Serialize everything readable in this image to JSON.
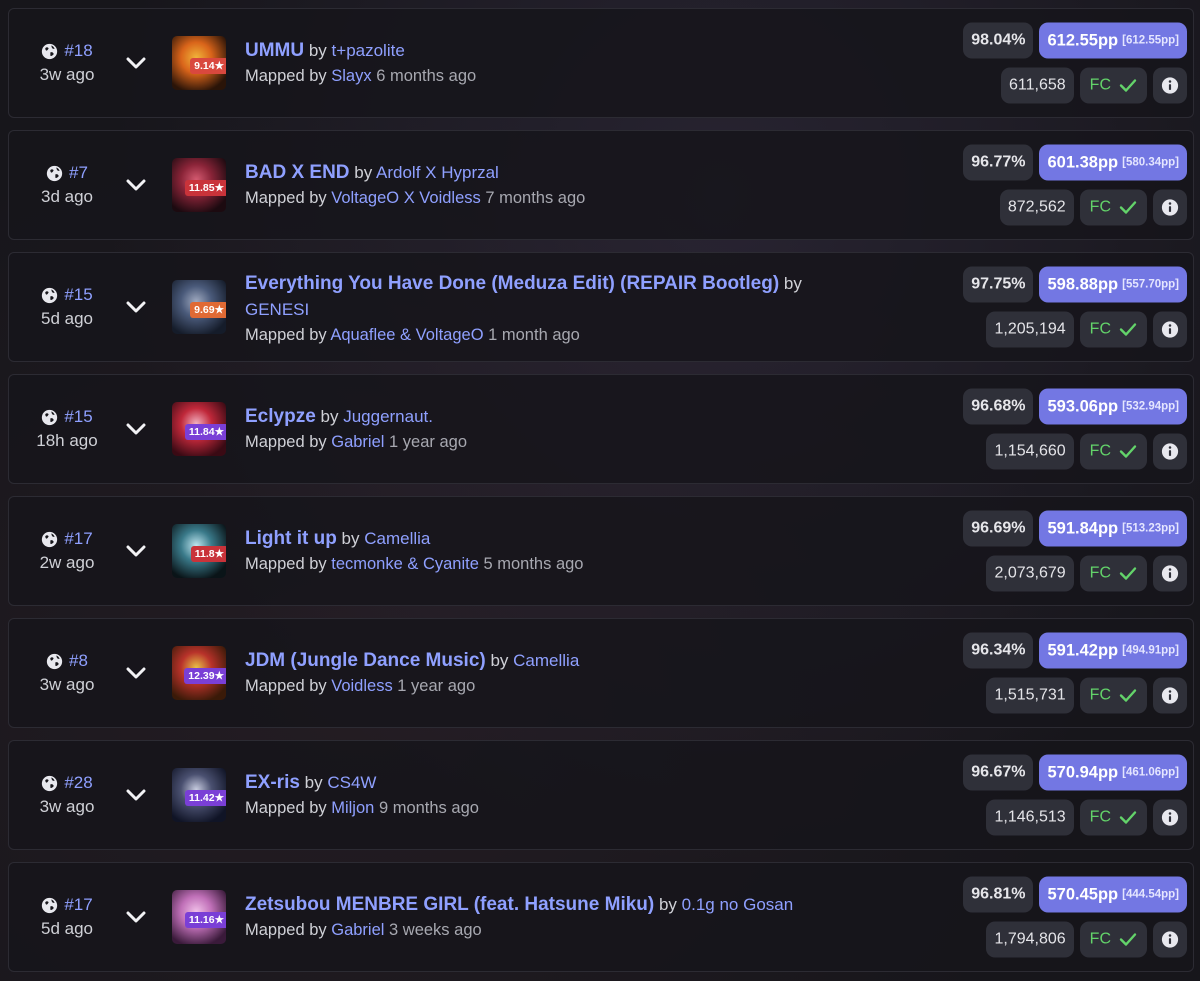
{
  "scores": [
    {
      "rank": "#18",
      "time": "3w ago",
      "stars": "9.14★",
      "star_color": "#d9483e",
      "cover_colors": [
        "#2a1408",
        "#d9641a",
        "#f0b43a"
      ],
      "title": "UMMU",
      "by": "by",
      "artist": "t+pazolite",
      "mapped_by": "Mapped by",
      "mapper": "Slayx",
      "mapped_ago": "6 months ago",
      "accuracy": "98.04%",
      "pp": "612.55pp",
      "pp_weighted": "[612.55pp]",
      "score": "611,658",
      "fc": "FC"
    },
    {
      "rank": "#7",
      "time": "3d ago",
      "stars": "11.85★",
      "star_color": "#c9333a",
      "cover_colors": [
        "#1c0a10",
        "#8a2438",
        "#d45a70"
      ],
      "title": "BAD X END",
      "by": "by",
      "artist": "Ardolf X Hyprzal",
      "mapped_by": "Mapped by",
      "mapper": "VoltageO X Voidless",
      "mapped_ago": "7 months ago",
      "accuracy": "96.77%",
      "pp": "601.38pp",
      "pp_weighted": "[580.34pp]",
      "score": "872,562",
      "fc": "FC"
    },
    {
      "rank": "#15",
      "time": "5d ago",
      "stars": "9.69★",
      "star_color": "#e06a34",
      "cover_colors": [
        "#151c2a",
        "#4a5a7a",
        "#a0aac0"
      ],
      "title": "Everything You Have Done (Meduza Edit) (REPAIR Bootleg)",
      "by": "by",
      "artist": "GENESI",
      "mapped_by": "Mapped by",
      "mapper": "Aquaflee & VoltageO",
      "mapped_ago": "1 month ago",
      "accuracy": "97.75%",
      "pp": "598.88pp",
      "pp_weighted": "[557.70pp]",
      "score": "1,205,194",
      "fc": "FC"
    },
    {
      "rank": "#15",
      "time": "18h ago",
      "stars": "11.84★",
      "star_color": "#7a3fd6",
      "cover_colors": [
        "#3a0a14",
        "#c0283a",
        "#f2b0c0"
      ],
      "title": "Eclypze",
      "by": "by",
      "artist": "Juggernaut.",
      "mapped_by": "Mapped by",
      "mapper": "Gabriel",
      "mapped_ago": "1 year ago",
      "accuracy": "96.68%",
      "pp": "593.06pp",
      "pp_weighted": "[532.94pp]",
      "score": "1,154,660",
      "fc": "FC"
    },
    {
      "rank": "#17",
      "time": "2w ago",
      "stars": "11.8★",
      "star_color": "#c9333a",
      "cover_colors": [
        "#0a1418",
        "#3a7a8a",
        "#bfe6f0"
      ],
      "title": "Light it up",
      "by": "by",
      "artist": "Camellia",
      "mapped_by": "Mapped by",
      "mapper": "tecmonke & Cyanite",
      "mapped_ago": "5 months ago",
      "accuracy": "96.69%",
      "pp": "591.84pp",
      "pp_weighted": "[513.23pp]",
      "score": "2,073,679",
      "fc": "FC"
    },
    {
      "rank": "#8",
      "time": "3w ago",
      "stars": "12.39★",
      "star_color": "#7a3fd6",
      "cover_colors": [
        "#3a1a08",
        "#b8322a",
        "#e8c048"
      ],
      "title": "JDM (Jungle Dance Music)",
      "by": "by",
      "artist": "Camellia",
      "mapped_by": "Mapped by",
      "mapper": "Voidless",
      "mapped_ago": "1 year ago",
      "accuracy": "96.34%",
      "pp": "591.42pp",
      "pp_weighted": "[494.91pp]",
      "score": "1,515,731",
      "fc": "FC"
    },
    {
      "rank": "#28",
      "time": "3w ago",
      "stars": "11.42★",
      "star_color": "#7a3fd6",
      "cover_colors": [
        "#101426",
        "#4a5070",
        "#c8cce0"
      ],
      "title": "EX-ris",
      "by": "by",
      "artist": "CS4W",
      "mapped_by": "Mapped by",
      "mapper": "Miljon",
      "mapped_ago": "9 months ago",
      "accuracy": "96.67%",
      "pp": "570.94pp",
      "pp_weighted": "[461.06pp]",
      "score": "1,146,513",
      "fc": "FC"
    },
    {
      "rank": "#17",
      "time": "5d ago",
      "stars": "11.16★",
      "star_color": "#7a3fd6",
      "cover_colors": [
        "#3a1a3a",
        "#c070b8",
        "#f0c0e8"
      ],
      "title": "Zetsubou MENBRE GIRL (feat. Hatsune Miku)",
      "by": "by",
      "artist": "0.1g no Gosan",
      "mapped_by": "Mapped by",
      "mapper": "Gabriel",
      "mapped_ago": "3 weeks ago",
      "accuracy": "96.81%",
      "pp": "570.45pp",
      "pp_weighted": "[444.54pp]",
      "score": "1,794,806",
      "fc": "FC"
    }
  ]
}
